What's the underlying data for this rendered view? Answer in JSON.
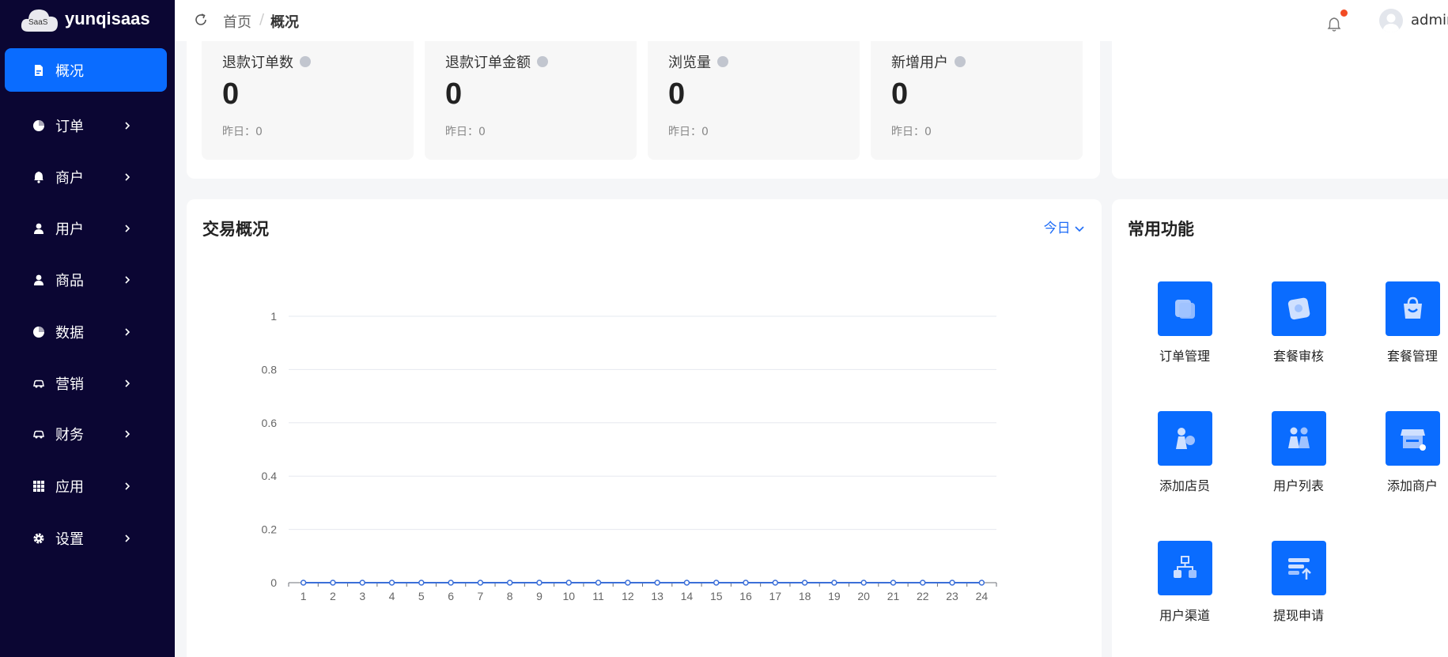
{
  "app": {
    "logo_badge": "SaaS",
    "name": "yunqisaas"
  },
  "sidebar": {
    "items": [
      {
        "label": "概况",
        "icon": "document-icon",
        "active": true
      },
      {
        "label": "订单",
        "icon": "pie-icon"
      },
      {
        "label": "商户",
        "icon": "bell-icon"
      },
      {
        "label": "用户",
        "icon": "user-icon"
      },
      {
        "label": "商品",
        "icon": "user-icon"
      },
      {
        "label": "数据",
        "icon": "pie-icon"
      },
      {
        "label": "营销",
        "icon": "car-icon"
      },
      {
        "label": "财务",
        "icon": "car-icon"
      },
      {
        "label": "应用",
        "icon": "grid-icon"
      },
      {
        "label": "设置",
        "icon": "gear-icon"
      }
    ]
  },
  "header": {
    "breadcrumb_home": "首页",
    "breadcrumb_sep": "/",
    "breadcrumb_current": "概况",
    "user_name": "admin",
    "notification_dot_color": "#f24b24"
  },
  "stats": [
    {
      "label": "退款订单数",
      "value": "0",
      "yesterday": "昨日：0"
    },
    {
      "label": "退款订单金额",
      "value": "0",
      "yesterday": "昨日：0"
    },
    {
      "label": "浏览量",
      "value": "0",
      "yesterday": "昨日：0"
    },
    {
      "label": "新增用户",
      "value": "0",
      "yesterday": "昨日：0"
    }
  ],
  "transaction": {
    "title": "交易概况",
    "period": "今日"
  },
  "chart_data": {
    "type": "line",
    "title": "",
    "xlabel": "",
    "ylabel": "",
    "x": [
      1,
      2,
      3,
      4,
      5,
      6,
      7,
      8,
      9,
      10,
      11,
      12,
      13,
      14,
      15,
      16,
      17,
      18,
      19,
      20,
      21,
      22,
      23,
      24
    ],
    "y_ticks": [
      "0",
      "0.2",
      "0.4",
      "0.6",
      "0.8",
      "1"
    ],
    "ylim": [
      0,
      1
    ],
    "grid": true,
    "series": [
      {
        "values": [
          0,
          0,
          0,
          0,
          0,
          0,
          0,
          0,
          0,
          0,
          0,
          0,
          0,
          0,
          0,
          0,
          0,
          0,
          0,
          0,
          0,
          0,
          0,
          0
        ],
        "color": "#3b6fd8"
      }
    ]
  },
  "functions": {
    "title": "常用功能",
    "items": [
      {
        "label": "订单管理",
        "icon": "order-management-icon"
      },
      {
        "label": "套餐审核",
        "icon": "package-review-icon"
      },
      {
        "label": "套餐管理",
        "icon": "shopping-bag-icon"
      },
      {
        "label": "添加店员",
        "icon": "add-clerk-icon"
      },
      {
        "label": "用户列表",
        "icon": "user-list-icon"
      },
      {
        "label": "添加商户",
        "icon": "store-icon"
      },
      {
        "label": "用户渠道",
        "icon": "org-chart-icon"
      },
      {
        "label": "提现申请",
        "icon": "withdraw-icon"
      }
    ]
  },
  "colors": {
    "sidebar_bg": "#0b0633",
    "accent": "#0a6cff",
    "link": "#1d6cf7"
  }
}
